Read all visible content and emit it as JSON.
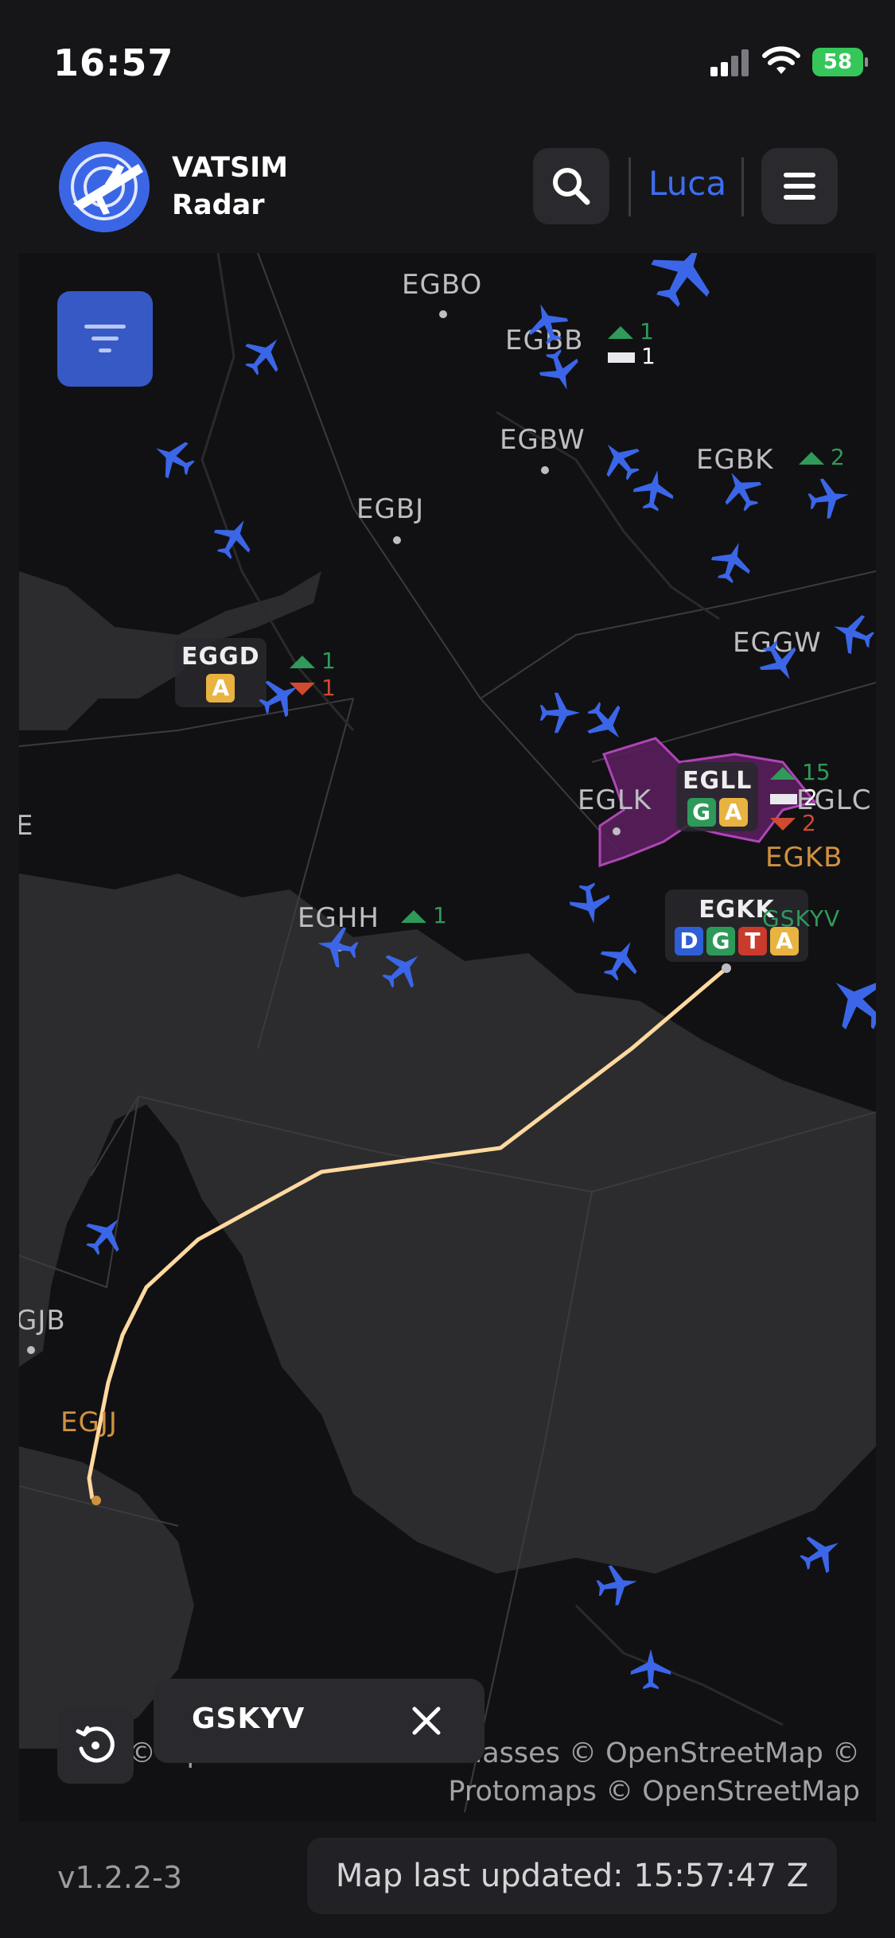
{
  "status_bar": {
    "time": "16:57",
    "battery": "58"
  },
  "header": {
    "app_name_line1": "VATSIM",
    "app_name_line2": "Radar",
    "user_name": "Luca",
    "search_icon": "search-icon",
    "menu_icon": "hamburger-menu-icon"
  },
  "map": {
    "filter_icon": "filter-icon",
    "airports": [
      {
        "code": "EGBO"
      },
      {
        "code": "EGBB"
      },
      {
        "code": "EGBW"
      },
      {
        "code": "EGBK"
      },
      {
        "code": "EGBJ"
      },
      {
        "code": "EGGW"
      },
      {
        "code": "EGLK"
      },
      {
        "code": "EGLC"
      },
      {
        "code": "EGKB"
      },
      {
        "code": "EGHH"
      },
      {
        "code": "E"
      },
      {
        "code": "GJB"
      },
      {
        "code": "EGJJ"
      }
    ],
    "counts": {
      "egbb_up": "1",
      "egbb_bar": "1",
      "egbk_up": "2",
      "eggd_up": "1",
      "eggd_down": "1",
      "egll_up": "15",
      "egll_bar": "2",
      "egll_down": "2",
      "eghh_up": "1"
    },
    "atc": [
      {
        "code": "EGGD",
        "letters": [
          "A"
        ]
      },
      {
        "code": "EGLL",
        "letters": [
          "G",
          "A"
        ]
      },
      {
        "code": "EGKK",
        "letters": [
          "D",
          "G",
          "T",
          "A"
        ]
      }
    ],
    "selected_label": "GSKYV",
    "attribution_line1": "© OpenWeather © VATGlasses © OpenStreetMap ©",
    "attribution_line2": "Protomaps © OpenStreetMap",
    "colors": {
      "route": "#ffd9a0",
      "plane": "#3b66e8",
      "atc_A": "#e8b340",
      "atc_G": "#2d9a5a",
      "atc_D": "#2f5fd6",
      "atc_T": "#c93b2c",
      "sector_fill": "#6a2a6a"
    }
  },
  "selection_chip": {
    "callsign": "GSKYV",
    "close_icon": "close-icon"
  },
  "recenter_icon": "history-recenter-icon",
  "footer": {
    "version": "v1.2.2-3",
    "last_updated": "Map last updated: 15:57:47 Z"
  }
}
